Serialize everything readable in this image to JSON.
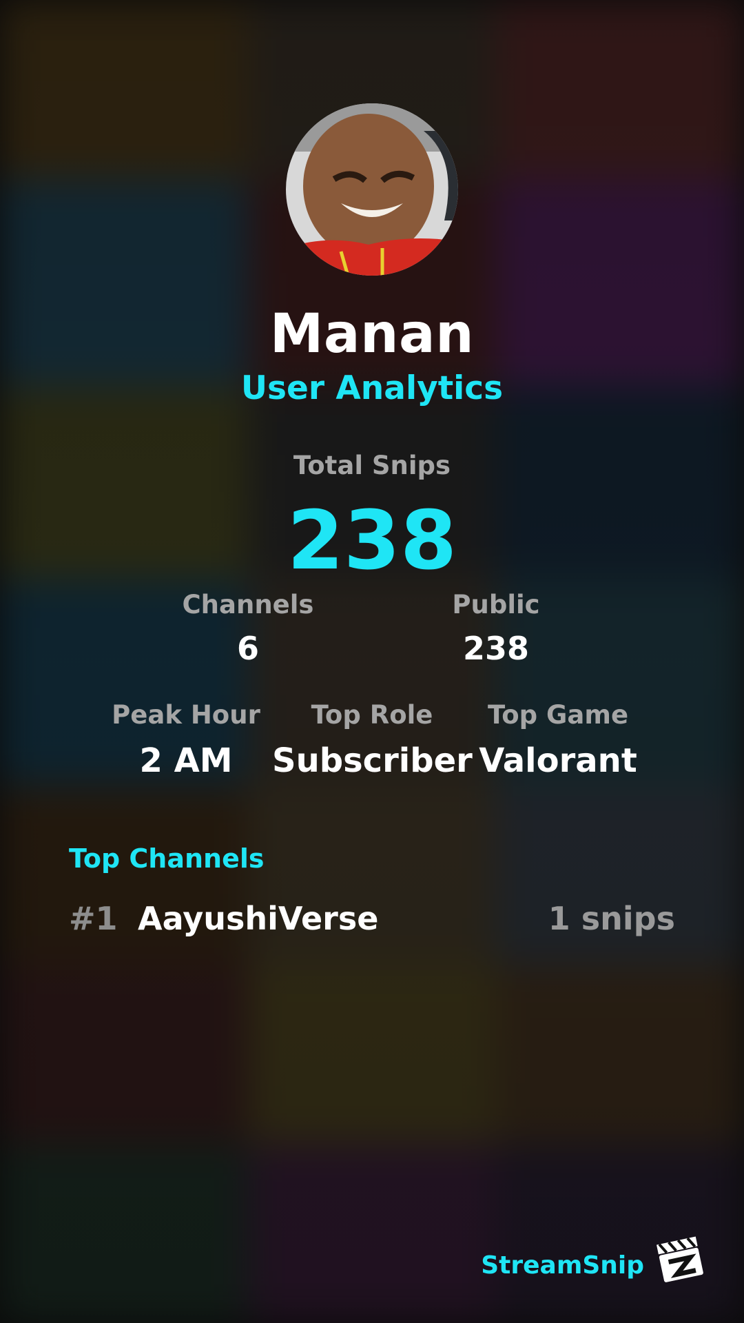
{
  "profile": {
    "name": "Manan",
    "subtitle": "User Analytics"
  },
  "total": {
    "label": "Total Snips",
    "value": "238"
  },
  "stats_row1": [
    {
      "label": "Channels",
      "value": "6"
    },
    {
      "label": "Public",
      "value": "238"
    }
  ],
  "stats_row2": [
    {
      "label": "Peak Hour",
      "value": "2 AM"
    },
    {
      "label": "Top Role",
      "value": "Subscriber"
    },
    {
      "label": "Top Game",
      "value": "Valorant"
    }
  ],
  "top_channels": {
    "title": "Top Channels",
    "items": [
      {
        "rank": "#1",
        "name": "AayushiVerse",
        "count": "1 snips"
      }
    ]
  },
  "footer": {
    "brand": "StreamSnip"
  },
  "colors": {
    "accent": "#1fe5f5",
    "label": "#a5a5a5",
    "text": "#ffffff"
  },
  "icons": {
    "logo": "streamsnip-clapperboard-icon"
  }
}
